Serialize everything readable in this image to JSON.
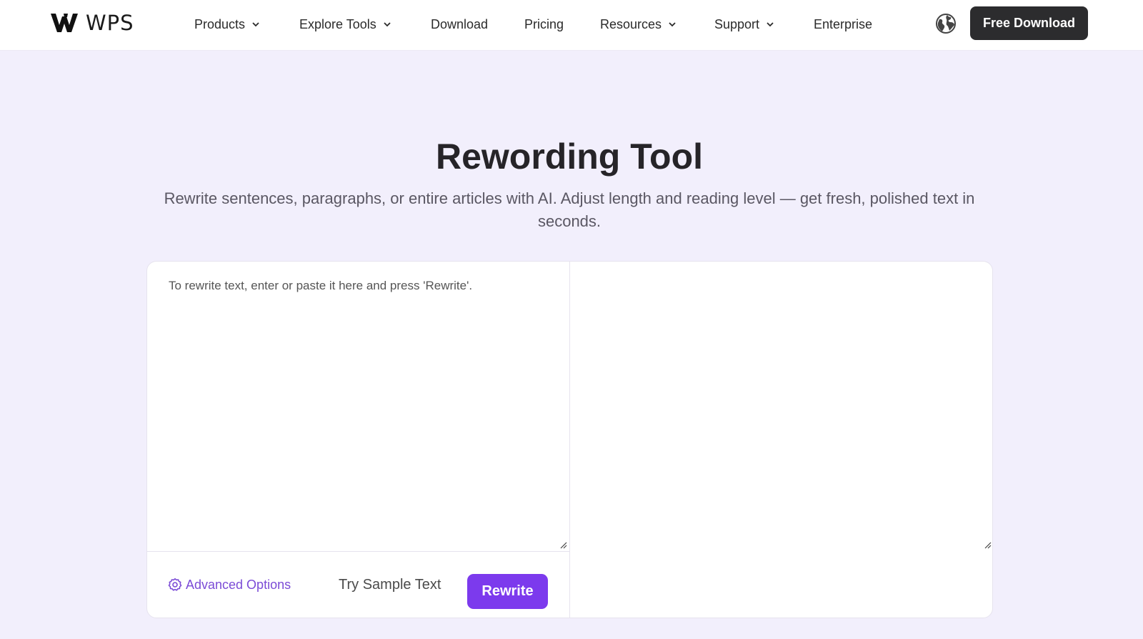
{
  "brand": {
    "name": "WPS",
    "accent": "#7c3aed",
    "dark_button": "#2c2c2e"
  },
  "nav": {
    "items": [
      {
        "label": "Products",
        "has_dropdown": true
      },
      {
        "label": "Explore Tools",
        "has_dropdown": true
      },
      {
        "label": "Download",
        "has_dropdown": false
      },
      {
        "label": "Pricing",
        "has_dropdown": false
      },
      {
        "label": "Resources",
        "has_dropdown": true
      },
      {
        "label": "Support",
        "has_dropdown": true
      },
      {
        "label": "Enterprise",
        "has_dropdown": false
      }
    ],
    "language_icon": "globe-icon",
    "cta_label": "Free Download"
  },
  "hero": {
    "title": "Rewording Tool",
    "subtitle": "Rewrite sentences, paragraphs, or entire articles with AI. Adjust length and reading level — get fresh, polished text in seconds."
  },
  "tool": {
    "input_placeholder": "To rewrite text, enter or paste it here and press 'Rewrite'.",
    "input_value": "",
    "output_value": "",
    "advanced_options_label": "Advanced Options",
    "advanced_options_icon": "gear-icon",
    "sample_label": "Try Sample Text",
    "rewrite_label": "Rewrite"
  }
}
